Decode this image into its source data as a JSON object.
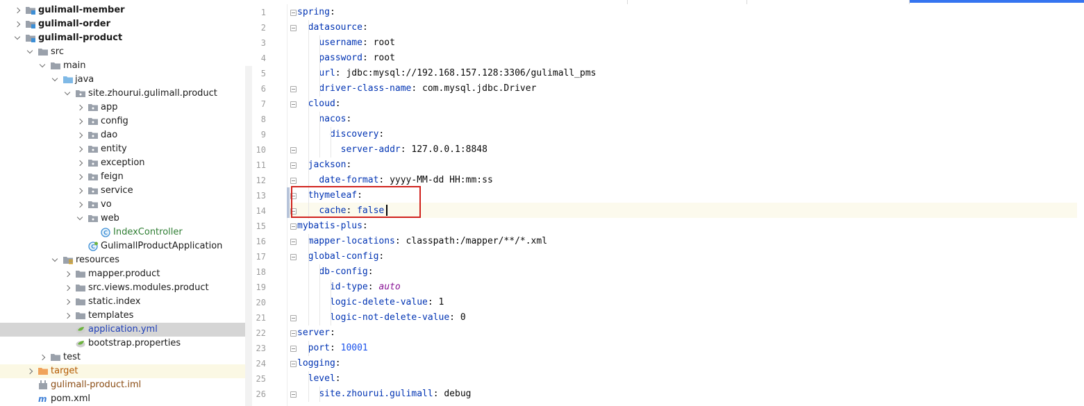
{
  "project_tree": {
    "items": [
      {
        "label": "gulimall-member",
        "icon": "module-folder-icon",
        "name": "tree-item-gulimall-member"
      },
      {
        "label": "gulimall-order",
        "icon": "module-folder-icon",
        "name": "tree-item-gulimall-order"
      },
      {
        "label": "gulimall-product",
        "icon": "module-folder-icon",
        "name": "tree-item-gulimall-product"
      },
      {
        "label": "src",
        "icon": "folder-icon",
        "name": "tree-item-src"
      },
      {
        "label": "main",
        "icon": "folder-icon",
        "name": "tree-item-main"
      },
      {
        "label": "java",
        "icon": "source-folder-icon",
        "name": "tree-item-java"
      },
      {
        "label": "site.zhourui.gulimall.product",
        "icon": "package-icon",
        "name": "tree-item-package"
      },
      {
        "label": "app",
        "icon": "package-icon",
        "name": "tree-item-app"
      },
      {
        "label": "config",
        "icon": "package-icon",
        "name": "tree-item-config"
      },
      {
        "label": "dao",
        "icon": "package-icon",
        "name": "tree-item-dao"
      },
      {
        "label": "entity",
        "icon": "package-icon",
        "name": "tree-item-entity"
      },
      {
        "label": "exception",
        "icon": "package-icon",
        "name": "tree-item-exception"
      },
      {
        "label": "feign",
        "icon": "package-icon",
        "name": "tree-item-feign"
      },
      {
        "label": "service",
        "icon": "package-icon",
        "name": "tree-item-service"
      },
      {
        "label": "vo",
        "icon": "package-icon",
        "name": "tree-item-vo"
      },
      {
        "label": "web",
        "icon": "package-icon",
        "name": "tree-item-web"
      },
      {
        "label": "IndexController",
        "icon": "java-class-icon",
        "name": "tree-item-indexcontroller"
      },
      {
        "label": "GulimallProductApplication",
        "icon": "spring-boot-class-icon",
        "name": "tree-item-application-class"
      },
      {
        "label": "resources",
        "icon": "resources-folder-icon",
        "name": "tree-item-resources"
      },
      {
        "label": "mapper.product",
        "icon": "folder-icon",
        "name": "tree-item-mapper-product"
      },
      {
        "label": "src.views.modules.product",
        "icon": "folder-icon",
        "name": "tree-item-src-views"
      },
      {
        "label": "static.index",
        "icon": "folder-icon",
        "name": "tree-item-static-index"
      },
      {
        "label": "templates",
        "icon": "folder-icon",
        "name": "tree-item-templates"
      },
      {
        "label": "application.yml",
        "icon": "yaml-spring-icon",
        "name": "tree-item-application-yml"
      },
      {
        "label": "bootstrap.properties",
        "icon": "spring-properties-icon",
        "name": "tree-item-bootstrap-properties"
      },
      {
        "label": "test",
        "icon": "folder-icon",
        "name": "tree-item-test"
      },
      {
        "label": "target",
        "icon": "excluded-folder-icon",
        "name": "tree-item-target"
      },
      {
        "label": "gulimall-product.iml",
        "icon": "iml-file-icon",
        "name": "tree-item-iml"
      },
      {
        "label": "pom.xml",
        "icon": "maven-icon",
        "name": "tree-item-pom"
      }
    ]
  },
  "editor": {
    "line_numbers": [
      "1",
      "2",
      "3",
      "4",
      "5",
      "6",
      "7",
      "8",
      "9",
      "10",
      "11",
      "12",
      "13",
      "14",
      "15",
      "16",
      "17",
      "18",
      "19",
      "20",
      "21",
      "22",
      "23",
      "24",
      "25",
      "26"
    ],
    "lines": [
      [
        {
          "t": "spring",
          "c": "k"
        },
        {
          "t": ":",
          "c": "p"
        }
      ],
      [
        {
          "t": "  "
        },
        {
          "t": "datasource",
          "c": "k"
        },
        {
          "t": ":",
          "c": "p"
        }
      ],
      [
        {
          "t": "    "
        },
        {
          "t": "username",
          "c": "k"
        },
        {
          "t": ": ",
          "c": "p"
        },
        {
          "t": "root",
          "c": "v"
        }
      ],
      [
        {
          "t": "    "
        },
        {
          "t": "password",
          "c": "k"
        },
        {
          "t": ": ",
          "c": "p"
        },
        {
          "t": "root",
          "c": "v"
        }
      ],
      [
        {
          "t": "    "
        },
        {
          "t": "url",
          "c": "k"
        },
        {
          "t": ": ",
          "c": "p"
        },
        {
          "t": "jdbc:mysql://192.168.157.128:3306/gulimall_pms",
          "c": "v"
        }
      ],
      [
        {
          "t": "    "
        },
        {
          "t": "driver-class-name",
          "c": "k"
        },
        {
          "t": ": ",
          "c": "p"
        },
        {
          "t": "com.mysql.jdbc.Driver",
          "c": "v"
        }
      ],
      [
        {
          "t": "  "
        },
        {
          "t": "cloud",
          "c": "k"
        },
        {
          "t": ":",
          "c": "p"
        }
      ],
      [
        {
          "t": "    "
        },
        {
          "t": "nacos",
          "c": "k"
        },
        {
          "t": ":",
          "c": "p"
        }
      ],
      [
        {
          "t": "      "
        },
        {
          "t": "discovery",
          "c": "k"
        },
        {
          "t": ":",
          "c": "p"
        }
      ],
      [
        {
          "t": "        "
        },
        {
          "t": "server-addr",
          "c": "k"
        },
        {
          "t": ": ",
          "c": "p"
        },
        {
          "t": "127.0.0.1:8848",
          "c": "v"
        }
      ],
      [
        {
          "t": "  "
        },
        {
          "t": "jackson",
          "c": "k"
        },
        {
          "t": ":",
          "c": "p"
        }
      ],
      [
        {
          "t": "    "
        },
        {
          "t": "date-format",
          "c": "k"
        },
        {
          "t": ": ",
          "c": "p"
        },
        {
          "t": "yyyy-MM-dd HH:mm:ss",
          "c": "v"
        }
      ],
      [
        {
          "t": "  "
        },
        {
          "t": "thymeleaf",
          "c": "k"
        },
        {
          "t": ":",
          "c": "p"
        }
      ],
      [
        {
          "t": "    "
        },
        {
          "t": "cache",
          "c": "k"
        },
        {
          "t": ": ",
          "c": "p"
        },
        {
          "t": "false",
          "c": "kw"
        }
      ],
      [
        {
          "t": "mybatis-plus",
          "c": "k"
        },
        {
          "t": ":",
          "c": "p"
        }
      ],
      [
        {
          "t": "  "
        },
        {
          "t": "mapper-locations",
          "c": "k"
        },
        {
          "t": ": ",
          "c": "p"
        },
        {
          "t": "classpath:/mapper/**/*.xml",
          "c": "v"
        }
      ],
      [
        {
          "t": "  "
        },
        {
          "t": "global-config",
          "c": "k"
        },
        {
          "t": ":",
          "c": "p"
        }
      ],
      [
        {
          "t": "    "
        },
        {
          "t": "db-config",
          "c": "k"
        },
        {
          "t": ":",
          "c": "p"
        }
      ],
      [
        {
          "t": "      "
        },
        {
          "t": "id-type",
          "c": "k"
        },
        {
          "t": ": ",
          "c": "p"
        },
        {
          "t": "auto",
          "c": "it"
        }
      ],
      [
        {
          "t": "      "
        },
        {
          "t": "logic-delete-value",
          "c": "k"
        },
        {
          "t": ": ",
          "c": "p"
        },
        {
          "t": "1",
          "c": "v"
        }
      ],
      [
        {
          "t": "      "
        },
        {
          "t": "logic-not-delete-value",
          "c": "k"
        },
        {
          "t": ": ",
          "c": "p"
        },
        {
          "t": "0",
          "c": "v"
        }
      ],
      [
        {
          "t": "server",
          "c": "k"
        },
        {
          "t": ":",
          "c": "p"
        }
      ],
      [
        {
          "t": "  "
        },
        {
          "t": "port",
          "c": "k"
        },
        {
          "t": ": ",
          "c": "p"
        },
        {
          "t": "10001",
          "c": "num"
        }
      ],
      [
        {
          "t": "logging",
          "c": "k"
        },
        {
          "t": ":",
          "c": "p"
        }
      ],
      [
        {
          "t": "  "
        },
        {
          "t": "level",
          "c": "k"
        },
        {
          "t": ":",
          "c": "p"
        }
      ],
      [
        {
          "t": "    "
        },
        {
          "t": "site.zhourui.gulimall",
          "c": "k"
        },
        {
          "t": ": ",
          "c": "p"
        },
        {
          "t": "debug",
          "c": "v"
        }
      ]
    ]
  },
  "colors": {
    "key": "#0033b3",
    "number": "#1750eb",
    "italic_value": "#871094",
    "highlight_box": "#d0211c",
    "selected_row": "#d5d5d5",
    "active_tab": "#3574f0"
  }
}
